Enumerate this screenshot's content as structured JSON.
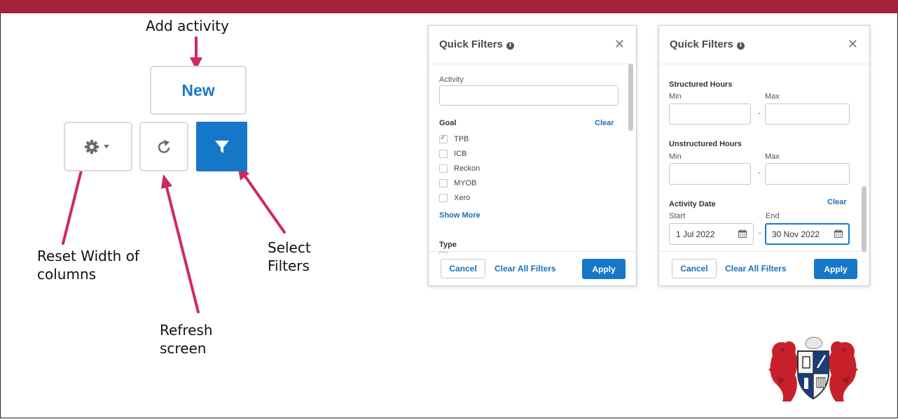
{
  "callouts": {
    "add_activity": "Add activity",
    "reset_width_line1": "Reset Width of",
    "reset_width_line2": "columns",
    "refresh_line1": "Refresh",
    "refresh_line2": "screen",
    "select_line1": "Select",
    "select_line2": "Filters"
  },
  "toolbar": {
    "new_label": "New",
    "icons": [
      "gear-icon",
      "caret-down-icon",
      "refresh-icon",
      "filter-icon"
    ]
  },
  "panel1": {
    "title": "Quick Filters",
    "activity_label": "Activity",
    "activity_value": "",
    "goal_label": "Goal",
    "goal_clear": "Clear",
    "goal_options": [
      {
        "label": "TPB",
        "checked": true
      },
      {
        "label": "ICB",
        "checked": false
      },
      {
        "label": "Reckon",
        "checked": false
      },
      {
        "label": "MYOB",
        "checked": false
      },
      {
        "label": "Xero",
        "checked": false
      }
    ],
    "show_more": "Show More",
    "type_label": "Type",
    "cancel": "Cancel",
    "clear_all": "Clear All Filters",
    "apply": "Apply"
  },
  "panel2": {
    "title": "Quick Filters",
    "structured_label": "Structured Hours",
    "unstructured_label": "Unstructured Hours",
    "min_label": "Min",
    "max_label": "Max",
    "dash": "-",
    "activity_date_label": "Activity Date",
    "date_clear": "Clear",
    "start_label": "Start",
    "end_label": "End",
    "start_value": "1 Jul 2022",
    "end_value": "30 Nov 2022",
    "cancel": "Cancel",
    "clear_all": "Clear All Filters",
    "apply": "Apply"
  },
  "colors": {
    "brand_bar": "#a3213a",
    "arrow": "#cc2b5e",
    "primary_blue": "#1677c8",
    "link_blue": "#1b6fbb"
  }
}
